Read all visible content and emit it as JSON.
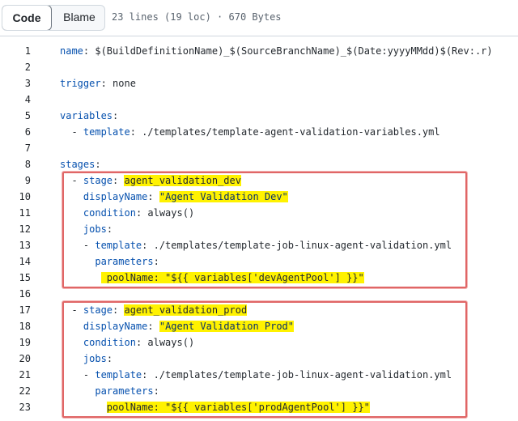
{
  "toolbar": {
    "code_label": "Code",
    "blame_label": "Blame",
    "file_info": "23 lines (19 loc) · 670 Bytes"
  },
  "code_lines": [
    {
      "n": "1",
      "segs": [
        {
          "t": "name",
          "c": "k"
        },
        {
          "t": ": $(BuildDefinitionName)_$(SourceBranchName)_$(Date:yyyyMMdd)$(Rev:.r)",
          "c": "v"
        }
      ]
    },
    {
      "n": "2",
      "segs": []
    },
    {
      "n": "3",
      "segs": [
        {
          "t": "trigger",
          "c": "k"
        },
        {
          "t": ": none",
          "c": "v"
        }
      ]
    },
    {
      "n": "4",
      "segs": []
    },
    {
      "n": "5",
      "segs": [
        {
          "t": "variables",
          "c": "k"
        },
        {
          "t": ":",
          "c": "p"
        }
      ]
    },
    {
      "n": "6",
      "segs": [
        {
          "t": "  - ",
          "c": "p"
        },
        {
          "t": "template",
          "c": "k"
        },
        {
          "t": ": ./templates/template-agent-validation-variables.yml",
          "c": "v"
        }
      ]
    },
    {
      "n": "7",
      "segs": []
    },
    {
      "n": "8",
      "segs": [
        {
          "t": "stages",
          "c": "k"
        },
        {
          "t": ":",
          "c": "p"
        }
      ]
    },
    {
      "n": "9",
      "segs": [
        {
          "t": "  - ",
          "c": "p"
        },
        {
          "t": "stage",
          "c": "k"
        },
        {
          "t": ": ",
          "c": "p"
        },
        {
          "t": "agent_validation_dev",
          "c": "v",
          "hl": true
        }
      ]
    },
    {
      "n": "10",
      "segs": [
        {
          "t": "    ",
          "c": "p"
        },
        {
          "t": "displayName",
          "c": "k"
        },
        {
          "t": ": ",
          "c": "p"
        },
        {
          "t": "\"Agent Validation Dev\"",
          "c": "s",
          "hl": true
        }
      ]
    },
    {
      "n": "11",
      "segs": [
        {
          "t": "    ",
          "c": "p"
        },
        {
          "t": "condition",
          "c": "k"
        },
        {
          "t": ": always()",
          "c": "v"
        }
      ]
    },
    {
      "n": "12",
      "segs": [
        {
          "t": "    ",
          "c": "p"
        },
        {
          "t": "jobs",
          "c": "k"
        },
        {
          "t": ":",
          "c": "p"
        }
      ]
    },
    {
      "n": "13",
      "segs": [
        {
          "t": "    - ",
          "c": "p"
        },
        {
          "t": "template",
          "c": "k"
        },
        {
          "t": ": ./templates/template-job-linux-agent-validation.yml",
          "c": "v"
        }
      ]
    },
    {
      "n": "14",
      "segs": [
        {
          "t": "      ",
          "c": "p"
        },
        {
          "t": "parameters",
          "c": "k"
        },
        {
          "t": ":",
          "c": "p"
        }
      ]
    },
    {
      "n": "15",
      "segs": [
        {
          "t": "       ",
          "c": "p"
        },
        {
          "t": " poolName: \"${{ variables['devAgentPool'] }}\"",
          "c": "mix",
          "hl": true
        }
      ]
    },
    {
      "n": "16",
      "segs": []
    },
    {
      "n": "17",
      "segs": [
        {
          "t": "  - ",
          "c": "p"
        },
        {
          "t": "stage",
          "c": "k"
        },
        {
          "t": ": ",
          "c": "p"
        },
        {
          "t": "agent_validation_prod",
          "c": "v",
          "hl": true
        }
      ]
    },
    {
      "n": "18",
      "segs": [
        {
          "t": "    ",
          "c": "p"
        },
        {
          "t": "displayName",
          "c": "k"
        },
        {
          "t": ": ",
          "c": "p"
        },
        {
          "t": "\"Agent Validation Prod\"",
          "c": "s",
          "hl": true
        }
      ]
    },
    {
      "n": "19",
      "segs": [
        {
          "t": "    ",
          "c": "p"
        },
        {
          "t": "condition",
          "c": "k"
        },
        {
          "t": ": always()",
          "c": "v"
        }
      ]
    },
    {
      "n": "20",
      "segs": [
        {
          "t": "    ",
          "c": "p"
        },
        {
          "t": "jobs",
          "c": "k"
        },
        {
          "t": ":",
          "c": "p"
        }
      ]
    },
    {
      "n": "21",
      "segs": [
        {
          "t": "    - ",
          "c": "p"
        },
        {
          "t": "template",
          "c": "k"
        },
        {
          "t": ": ./templates/template-job-linux-agent-validation.yml",
          "c": "v"
        }
      ]
    },
    {
      "n": "22",
      "segs": [
        {
          "t": "      ",
          "c": "p"
        },
        {
          "t": "parameters",
          "c": "k"
        },
        {
          "t": ":",
          "c": "p"
        }
      ]
    },
    {
      "n": "23",
      "segs": [
        {
          "t": "        ",
          "c": "p"
        },
        {
          "t": "poolName: \"${{ variables['prodAgentPool'] }}\"",
          "c": "mix",
          "hl": true
        }
      ]
    }
  ],
  "colors": {
    "highlight": "#fff200",
    "annotation_box": "#e06666",
    "key": "#0550ae",
    "string": "#0a3069"
  }
}
